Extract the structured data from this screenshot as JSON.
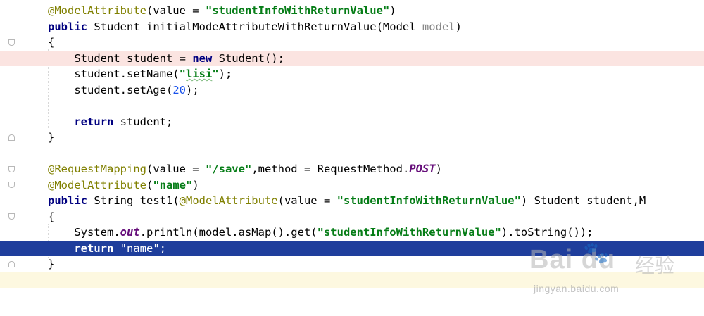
{
  "editor": {
    "lines": [
      {
        "tokens": [
          {
            "t": "@ModelAttribute",
            "c": "ann"
          },
          {
            "t": "(value = "
          },
          {
            "t": "\"studentInfoWithReturnValue\"",
            "c": "str"
          },
          {
            "t": ")"
          }
        ]
      },
      {
        "tokens": [
          {
            "t": "public",
            "c": "kw"
          },
          {
            "t": " Student initialModeAttributeWithReturnValue(Model "
          },
          {
            "t": "model",
            "c": "param"
          },
          {
            "t": ")"
          }
        ]
      },
      {
        "tokens": [
          {
            "t": "{"
          }
        ]
      },
      {
        "tokens": [
          {
            "t": "    Student student = "
          },
          {
            "t": "new",
            "c": "kw"
          },
          {
            "t": " Student();"
          }
        ]
      },
      {
        "tokens": [
          {
            "t": "    student.setName("
          },
          {
            "t": "\"",
            "c": "str"
          },
          {
            "t": "lisi",
            "c": "str typo"
          },
          {
            "t": "\"",
            "c": "str"
          },
          {
            "t": ");"
          }
        ]
      },
      {
        "tokens": [
          {
            "t": "    student.setAge("
          },
          {
            "t": "20",
            "c": "num"
          },
          {
            "t": ");"
          }
        ]
      },
      {
        "tokens": []
      },
      {
        "tokens": [
          {
            "t": "    "
          },
          {
            "t": "return",
            "c": "kw"
          },
          {
            "t": " student;"
          }
        ]
      },
      {
        "tokens": [
          {
            "t": "}"
          }
        ]
      },
      {
        "tokens": []
      },
      {
        "tokens": [
          {
            "t": "@RequestMapping",
            "c": "ann"
          },
          {
            "t": "(value = "
          },
          {
            "t": "\"/save\"",
            "c": "str"
          },
          {
            "t": ",method = RequestMethod."
          },
          {
            "t": "POST",
            "c": "field"
          },
          {
            "t": ")"
          }
        ]
      },
      {
        "tokens": [
          {
            "t": "@ModelAttribute",
            "c": "ann"
          },
          {
            "t": "("
          },
          {
            "t": "\"name\"",
            "c": "str"
          },
          {
            "t": ")"
          }
        ]
      },
      {
        "tokens": [
          {
            "t": "public",
            "c": "kw"
          },
          {
            "t": " String test1("
          },
          {
            "t": "@ModelAttribute",
            "c": "ann"
          },
          {
            "t": "(value = "
          },
          {
            "t": "\"studentInfoWithReturnValue\"",
            "c": "str"
          },
          {
            "t": ") Student student,M"
          }
        ]
      },
      {
        "tokens": [
          {
            "t": "{"
          }
        ]
      },
      {
        "tokens": [
          {
            "t": "    System."
          },
          {
            "t": "out",
            "c": "field"
          },
          {
            "t": ".println(model.asMap().get("
          },
          {
            "t": "\"studentInfoWithReturnValue\"",
            "c": "str"
          },
          {
            "t": ").toString());"
          }
        ]
      },
      {
        "tokens": [
          {
            "t": "    "
          },
          {
            "t": "return",
            "c": "kw"
          },
          {
            "t": " \"name\";"
          }
        ]
      },
      {
        "tokens": [
          {
            "t": "}"
          }
        ]
      },
      {
        "tokens": []
      }
    ],
    "highlights": {
      "3": "pink",
      "15": "selected",
      "17": "yellow"
    }
  },
  "watermark": {
    "logo": "Bai  du",
    "paw": "🐾",
    "cn": "经验",
    "url": "jingyan.baidu.com"
  }
}
